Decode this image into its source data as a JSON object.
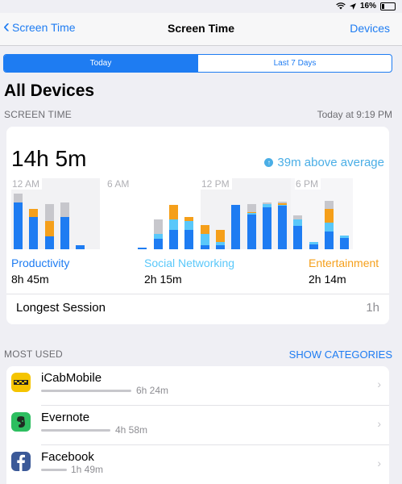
{
  "status_bar": {
    "battery": "16%",
    "wifi_icon": "wifi-icon",
    "location_icon": "location-arrow-icon"
  },
  "nav": {
    "back_label": "Screen Time",
    "title": "Screen Time",
    "right_label": "Devices"
  },
  "segments": [
    {
      "label": "Today",
      "selected": true
    },
    {
      "label": "Last 7 Days",
      "selected": false
    }
  ],
  "page_title": "All Devices",
  "screen_time": {
    "section_label": "SCREEN TIME",
    "timestamp": "Today at 9:19 PM",
    "total": "14h 5m",
    "average_text": "39m above average",
    "chart_ticks": [
      "12 AM",
      "6 AM",
      "12 PM",
      "6 PM"
    ],
    "colors": {
      "productivity": "#1e7cf2",
      "social": "#5ac8fa",
      "entertainment": "#f59f1a",
      "other": "#c7c7cc"
    },
    "hourly": [
      {
        "p": 0.8,
        "s": 0,
        "e": 0,
        "o": 0.16
      },
      {
        "p": 0.56,
        "s": 0,
        "e": 0.14,
        "o": 0
      },
      {
        "p": 0.22,
        "s": 0,
        "e": 0.26,
        "o": 0.3
      },
      {
        "p": 0.55,
        "s": 0,
        "e": 0,
        "o": 0.25
      },
      {
        "p": 0.07,
        "s": 0,
        "e": 0,
        "o": 0
      },
      {
        "p": 0,
        "s": 0,
        "e": 0,
        "o": 0
      },
      {
        "p": 0,
        "s": 0,
        "e": 0,
        "o": 0
      },
      {
        "p": 0,
        "s": 0,
        "e": 0,
        "o": 0
      },
      {
        "p": 0.03,
        "s": 0,
        "e": 0,
        "o": 0
      },
      {
        "p": 0.18,
        "s": 0.09,
        "e": 0,
        "o": 0.25
      },
      {
        "p": 0.33,
        "s": 0.19,
        "e": 0.25,
        "o": 0
      },
      {
        "p": 0.33,
        "s": 0.16,
        "e": 0.07,
        "o": 0
      },
      {
        "p": 0.07,
        "s": 0.19,
        "e": 0.16,
        "o": 0
      },
      {
        "p": 0.07,
        "s": 0.05,
        "e": 0.22,
        "o": 0
      },
      {
        "p": 0.77,
        "s": 0,
        "e": 0,
        "o": 0
      },
      {
        "p": 0.6,
        "s": 0.02,
        "e": 0.02,
        "o": 0.14
      },
      {
        "p": 0.72,
        "s": 0.06,
        "e": 0,
        "o": 0.02
      },
      {
        "p": 0.75,
        "s": 0.02,
        "e": 0.02,
        "o": 0.03
      },
      {
        "p": 0.4,
        "s": 0.12,
        "e": 0,
        "o": 0.06
      },
      {
        "p": 0.09,
        "s": 0.03,
        "e": 0,
        "o": 0
      },
      {
        "p": 0.31,
        "s": 0.15,
        "e": 0.24,
        "o": 0.13
      },
      {
        "p": 0.19,
        "s": 0.05,
        "e": 0,
        "o": 0
      }
    ],
    "legend": [
      {
        "name": "Productivity",
        "value": "8h 45m"
      },
      {
        "name": "Social Networking",
        "value": "2h 15m"
      },
      {
        "name": "Entertainment",
        "value": "2h 14m"
      }
    ],
    "longest_session_label": "Longest Session",
    "longest_session_value": "1h"
  },
  "most_used": {
    "section_label": "MOST USED",
    "show_categories": "SHOW CATEGORIES",
    "apps": [
      {
        "name": "iCabMobile",
        "time": "6h 24m",
        "fraction": 1.0,
        "icon": "icabmobile-icon"
      },
      {
        "name": "Evernote",
        "time": "4h 58m",
        "fraction": 0.77,
        "icon": "evernote-icon"
      },
      {
        "name": "Facebook",
        "time": "1h 49m",
        "fraction": 0.28,
        "icon": "facebook-icon"
      }
    ]
  }
}
